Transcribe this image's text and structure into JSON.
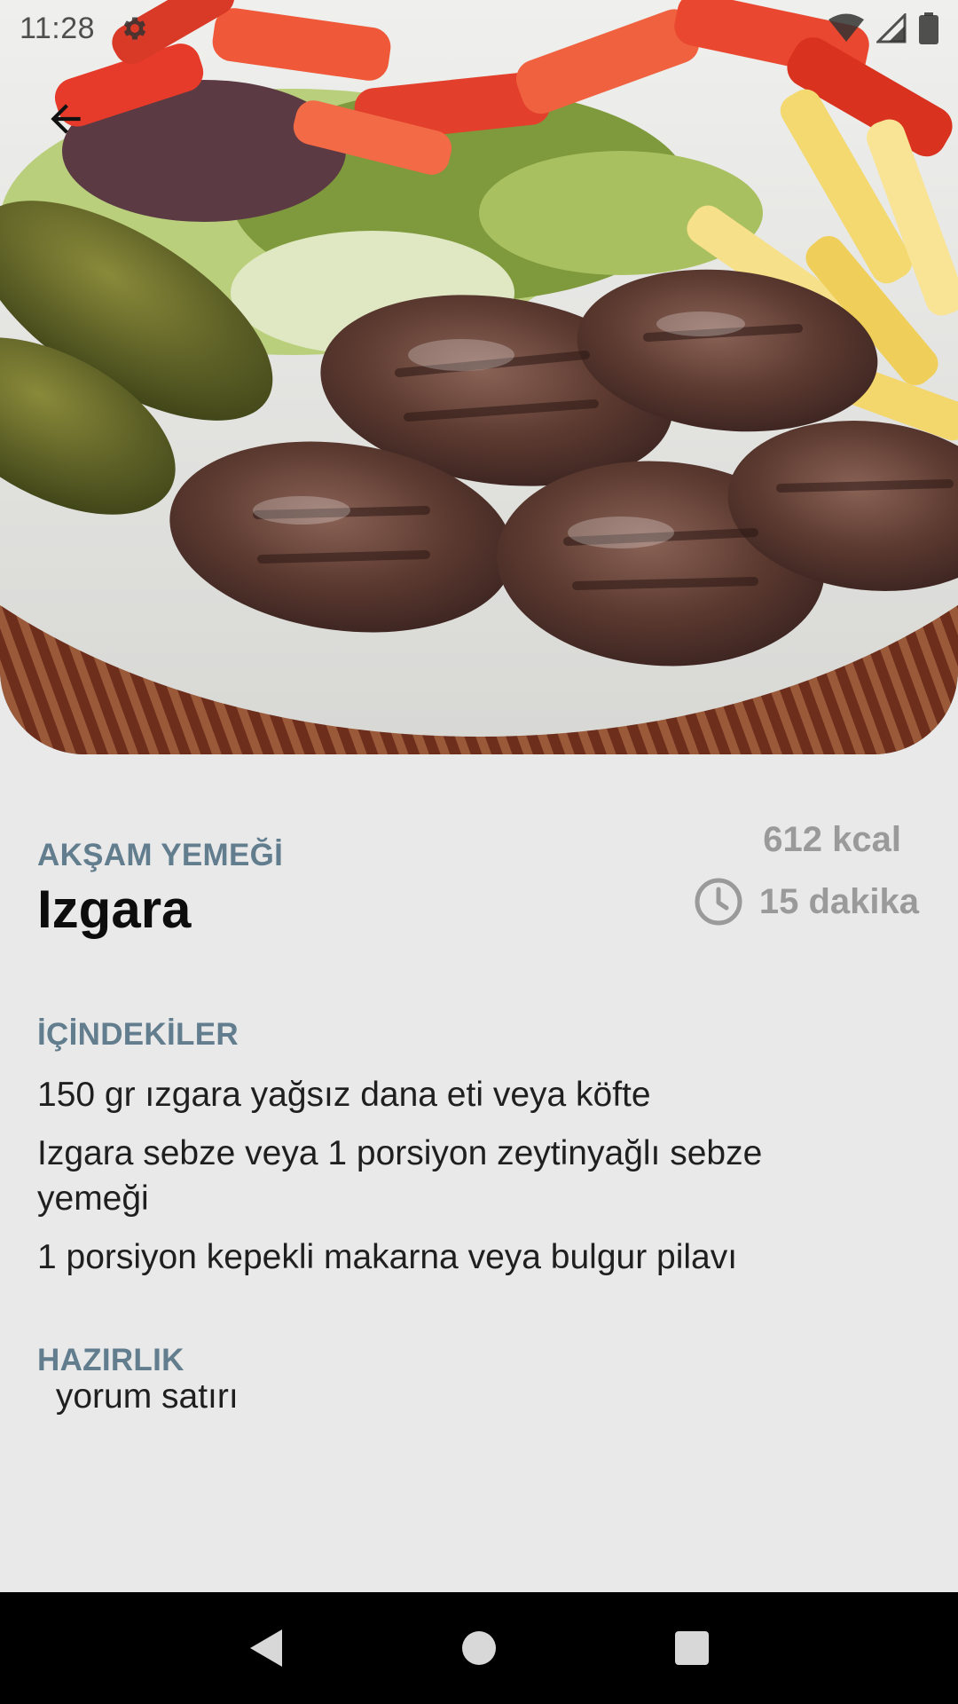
{
  "status_bar": {
    "time": "11:28",
    "icons": [
      "settings-gear-icon",
      "wifi-icon",
      "cellular-signal-icon",
      "battery-icon"
    ]
  },
  "hero": {
    "image": "food-photo-grilled-meatballs-with-salad-fries-pickles",
    "back_icon": "arrow-back-icon"
  },
  "recipe": {
    "category": "AKŞAM YEMEĞİ",
    "title": "Izgara",
    "calories": "612 kcal",
    "duration": "15 dakika",
    "duration_icon": "clock-icon"
  },
  "ingredients": {
    "label": "İÇİNDEKİLER",
    "items": [
      "150 gr ızgara yağsız dana eti veya köfte",
      "Izgara sebze veya 1 porsiyon zeytinyağlı sebze yemeği",
      "1 porsiyon kepekli makarna veya bulgur pilavı"
    ]
  },
  "preparation": {
    "label": "HAZIRLIK",
    "text": " yorum satırı"
  },
  "nav_bar": {
    "icons": [
      "nav-back-icon",
      "nav-home-icon",
      "nav-recents-icon"
    ]
  },
  "colors": {
    "background": "#e9e9ea",
    "section_label": "#627d8d",
    "secondary_text": "#9a9a9a",
    "nav_bar": "#000000"
  }
}
